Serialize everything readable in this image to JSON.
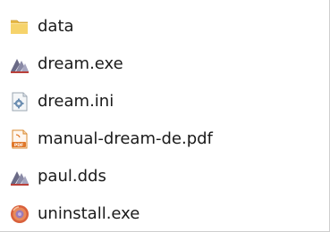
{
  "file_list": {
    "items": [
      {
        "name": "data",
        "icon": "folder-icon"
      },
      {
        "name": "dream.exe",
        "icon": "dream-app-icon"
      },
      {
        "name": "dream.ini",
        "icon": "settings-file-icon"
      },
      {
        "name": "manual-dream-de.pdf",
        "icon": "pdf-icon"
      },
      {
        "name": "paul.dds",
        "icon": "dream-app-icon"
      },
      {
        "name": "uninstall.exe",
        "icon": "uninstaller-icon"
      }
    ]
  }
}
